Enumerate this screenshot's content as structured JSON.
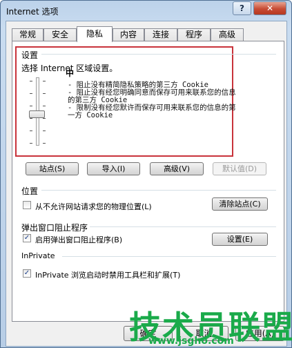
{
  "window": {
    "title": "Internet 选项",
    "help_label": "?",
    "close_label": "✕"
  },
  "tabs": [
    {
      "label": "常规"
    },
    {
      "label": "安全"
    },
    {
      "label": "隐私",
      "active": true
    },
    {
      "label": "内容"
    },
    {
      "label": "连接"
    },
    {
      "label": "程序"
    },
    {
      "label": "高级"
    }
  ],
  "settings": {
    "group_label": "设置",
    "prompt": "选择 Internet 区域设置。",
    "level": "中",
    "slider_position_percent": 55,
    "description_lines": [
      "- 阻止没有精简隐私策略的第三方 Cookie",
      "- 阻止没有经您明确同意而保存可用来联系您的信息",
      "的第三方 Cookie",
      "- 限制没有经您默许而保存可用来联系您的信息的第",
      "一方 Cookie"
    ]
  },
  "buttons": {
    "sites": "站点(S)",
    "import": "导入(I)",
    "advanced": "高级(V)",
    "default": "默认值(D)"
  },
  "location": {
    "group_label": "位置",
    "checkbox_label": "从不允许网站请求您的物理位置(L)",
    "checked": false,
    "clear_button": "清除站点(C)"
  },
  "popup": {
    "group_label": "弹出窗口阻止程序",
    "checkbox_label": "启用弹出窗口阻止程序(B)",
    "checked": true,
    "settings_button": "设置(E)"
  },
  "inprivate": {
    "group_label": "InPrivate",
    "checkbox_label": "InPrivate 浏览启动时禁用工具栏和扩展(T)",
    "checked": true
  },
  "dialog_buttons": {
    "ok": "确定",
    "cancel": "取消",
    "apply": "应用(A)"
  },
  "watermark": {
    "text": "技术员联盟",
    "url": "www.jsgho.com"
  }
}
